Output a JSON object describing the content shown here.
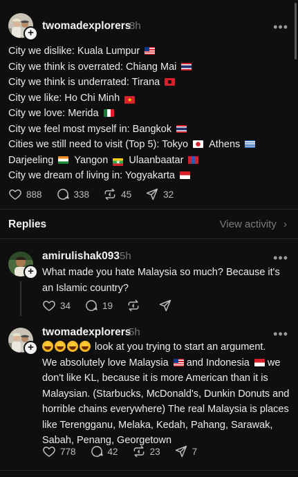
{
  "main_post": {
    "username": "twomadexplorers",
    "time": "8h",
    "lines": [
      {
        "text": "City we dislike: Kuala Lumpur",
        "flag": "my"
      },
      {
        "text": "City we think is overrated: Chiang Mai",
        "flag": "th"
      },
      {
        "text": "City we think is underrated: Tirana",
        "flag": "al"
      },
      {
        "text": "City we like: Ho Chi Minh",
        "flag": "vn"
      },
      {
        "text": "City we love: Merida",
        "flag": "mx"
      },
      {
        "text": "City we feel most myself in: Bangkok",
        "flag": "th"
      }
    ],
    "top5_intro": "Cities we still need to visit (Top 5): Tokyo",
    "top5_athens": "Athens",
    "top5_darjeeling": "Darjeeling",
    "top5_yangon": "Yangon",
    "top5_ulaanbaatar": "Ulaanbaatar",
    "dream_line": "City we dream of living in: Yogyakarta",
    "likes": "888",
    "comments": "338",
    "reposts": "45",
    "shares": "32"
  },
  "replies_section": {
    "title": "Replies",
    "view_activity": "View activity"
  },
  "reply_1": {
    "username": "amirulishak093",
    "time": "5h",
    "line1": "What made you hate Malaysia so much? Because it's",
    "line2": "an Islamic country?",
    "likes": "34",
    "comments": "19"
  },
  "reply_2": {
    "username": "twomadexplorers",
    "time": "5h",
    "line1": "look at you trying to start an argument.",
    "line2a": "We absolutely love Malaysia",
    "line2b": "and Indonesia",
    "line2c": "we",
    "line3": "don't like KL, because it is more American than it is",
    "line4": "Malaysian. (Starbucks, McDonald's, Dunkin Donuts and",
    "line5": "horrible chains everywhere) The real Malaysia is places",
    "line6": "like Terengganu, Melaka, Kedah, Pahang, Sarawak,",
    "line7": "Sabah, Penang, Georgetown",
    "likes": "778",
    "comments": "42",
    "reposts": "23",
    "shares": "7"
  },
  "icons": {
    "like": "heart-icon",
    "comment": "comment-bubble-icon",
    "repost": "repost-icon",
    "share": "send-icon",
    "more": "more-horizontal-icon",
    "follow": "plus-icon"
  },
  "colors": {
    "background": "#0f0f0f",
    "text": "#f3f3f3",
    "muted": "#777777"
  }
}
